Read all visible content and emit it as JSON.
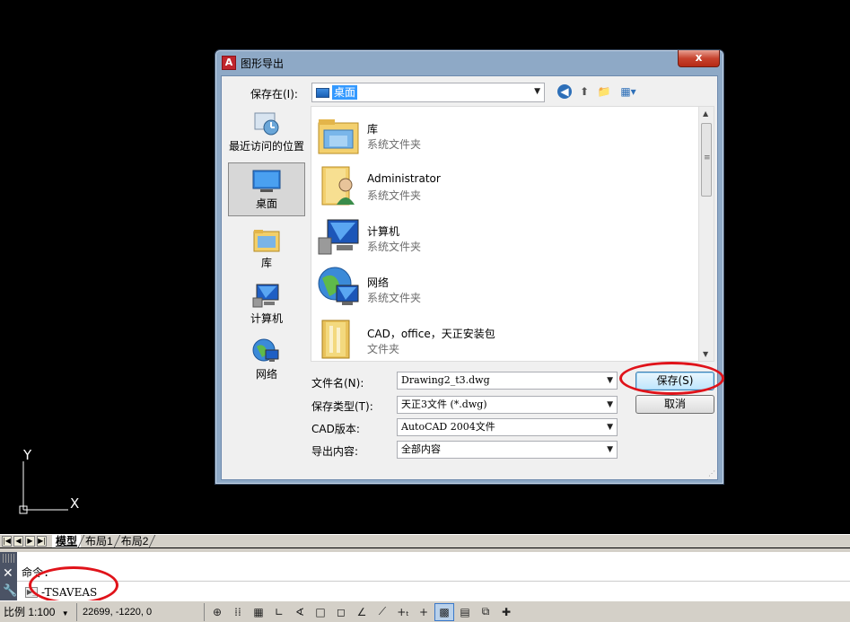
{
  "canvas": {
    "ucs_x": "X",
    "ucs_y": "Y"
  },
  "layout_tabs": [
    "模型",
    "布局1",
    "布局2"
  ],
  "command": {
    "line1": "命令:",
    "line2": "-TSAVEAS"
  },
  "status": {
    "scale": "比例 1:100",
    "coords": "22699, -1220, 0"
  },
  "dialog": {
    "title": "图形导出",
    "close": "x",
    "save_in_label": "保存在(I):",
    "save_in_value": "桌面",
    "places": [
      {
        "label": "最近访问的位置",
        "icon": "recent-places-icon"
      },
      {
        "label": "桌面",
        "icon": "desktop-icon"
      },
      {
        "label": "库",
        "icon": "libraries-icon"
      },
      {
        "label": "计算机",
        "icon": "computer-icon"
      },
      {
        "label": "网络",
        "icon": "network-icon"
      }
    ],
    "files": [
      {
        "name": "库",
        "type": "系统文件夹",
        "icon": "libraries-icon"
      },
      {
        "name": "Administrator",
        "type": "系统文件夹",
        "icon": "user-folder-icon"
      },
      {
        "name": "计算机",
        "type": "系统文件夹",
        "icon": "computer-icon"
      },
      {
        "name": "网络",
        "type": "系统文件夹",
        "icon": "network-icon"
      },
      {
        "name": "CAD，office，天正安装包",
        "type": "文件夹",
        "icon": "folder-icon"
      }
    ],
    "filename_label": "文件名(N):",
    "filename_value": "Drawing2_t3.dwg",
    "savetype_label": "保存类型(T):",
    "savetype_value": "天正3文件 (*.dwg)",
    "cad_version_label": "CAD版本:",
    "cad_version_value": "AutoCAD 2004文件",
    "export_content_label": "导出内容:",
    "export_content_value": "全部内容",
    "save_button": "保存(S)",
    "cancel_button": "取消"
  },
  "colors": {
    "annotation": "#e0131a",
    "accent": "#3399ff"
  }
}
